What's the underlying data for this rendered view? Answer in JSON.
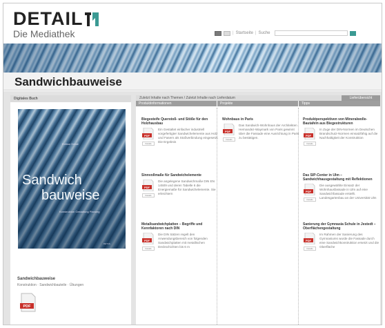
{
  "header": {
    "logo_text": "DETAIL",
    "subtitle": "Die Mediathek",
    "nav": {
      "home": "Startseite",
      "search": "Suche"
    }
  },
  "page": {
    "title": "Sandwichbauweise"
  },
  "left_panel": {
    "heading": "Digitales Buch",
    "cover": {
      "top_text": "Edition Detail",
      "title_line1": "Sandwich",
      "title_line2": "bauweise",
      "sub_text": "Konstruktion Gestaltung Planung",
      "publisher": "DETAIL"
    },
    "book_name": "Sandwichbauweise",
    "book_desc": "Konstruktion · Sandwichbauteile · Übungen",
    "pdf_label": "PDF"
  },
  "right_panel": {
    "tab_text": "Zuletzt Inhalte nach Themen / Zuletzt Inhalte nach Lieferdatum",
    "tab_active": "Lieferübersicht",
    "columns": [
      "Produktinformationen",
      "Projekte",
      "Tipps"
    ],
    "pdf_label": "PDF",
    "detail_label": "Details",
    "entries": [
      {
        "title": "Biegesteife Querstoß- und Stöße für den Holzhausbau",
        "text": "Ein Gestaltet einfacher industriell vorgefertigter Sandwichelemente aus Holz und Fasern als Stoßverbindung eingesetzt. Die Ergebnis"
      },
      {
        "title": "Sinnvollmaße für Sandwichelemente",
        "text": "Die angelegene Sandwichmaße DIN EN 14509 und deren Tabelle 6 die Energiemaße für Sandwichelemente. Sie erleichtern"
      },
      {
        "title": "Metallsandwichplatten – Begriffe und Kennfaktoren nach DIN",
        "text": "Die DIN Sätzen regelt den Anwendungsbereich von folgenden Sandwichplatten mit metallischen Deckschichten bis 6 m"
      },
      {
        "title": "Wohnbaus in Paris",
        "text": "Das Sandwich-Wohnhaus der Architekten Hernandez-Waymark von Paris gewinnt über die Fassade eine Ausrichtung in Paris zu bestätigen."
      },
      {
        "title": "Produktperspektiven von Mineralwolle-Bautafeln aus Biegestrukturen",
        "text": "In Zuge der DIN-Normen im Deutschen Brandschutz-Normen einsatzfähig auf die Nachhaltigkeit der Konstruktion"
      },
      {
        "title": "Das SIP-Center in Ulm – Sandwichhausgestaltung mit Reflektionen",
        "text": "Die ausgewählte Einsatz der Wohnhausfassade in Ulm auf eine Sandwichfassade erstellt. Landesgartenbau an der Universität Ulm"
      },
      {
        "title": "Sanierung der Gymnasia Schule in Jestedt – Oberflächengestaltung",
        "text": "Im Rahmen der Sanierung des Gymnasiums wurde die Fassade durch eine Sandwichkonstruktion ersetzt und die Oberfläche"
      }
    ]
  },
  "colors": {
    "accent": "#3b9a93",
    "pdf_red": "#c8302a",
    "column_header": "#9e9e9e"
  }
}
